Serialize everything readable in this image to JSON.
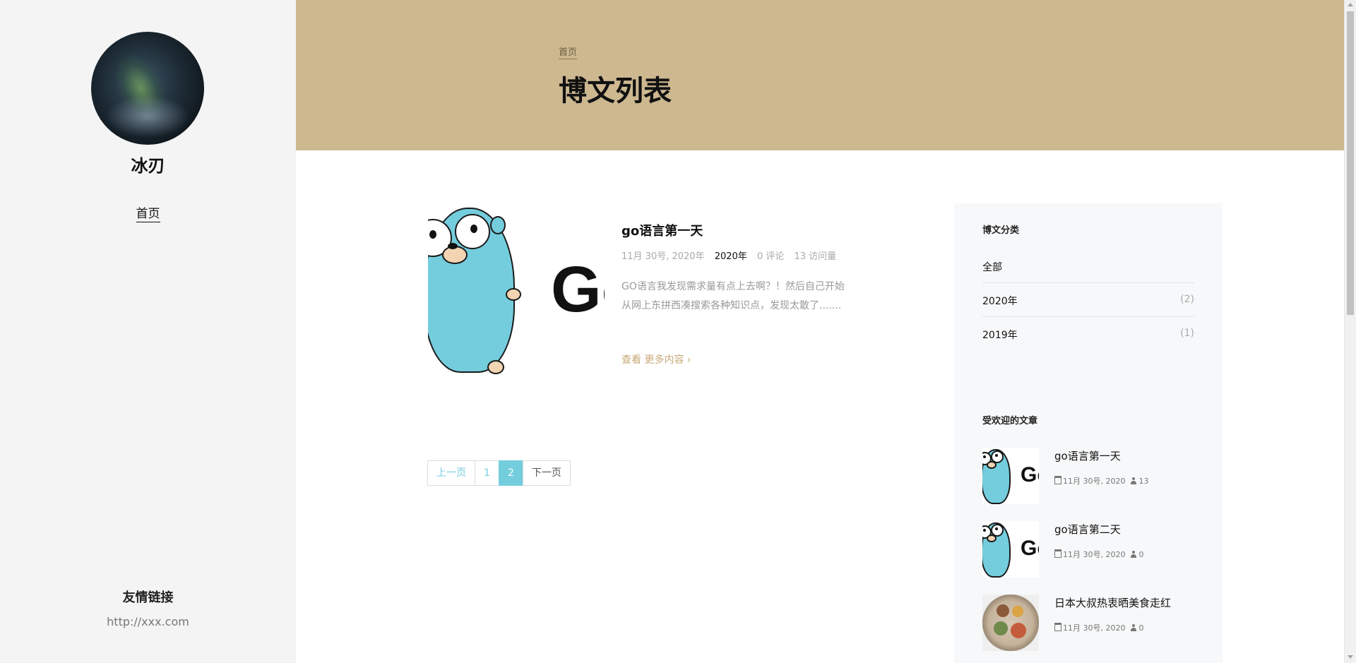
{
  "sidebar": {
    "author_name": "冰刃",
    "nav_home": "首页",
    "friend_links_title": "友情链接",
    "friend_link_url": "http://xxx.com"
  },
  "header": {
    "breadcrumb": "首页",
    "page_title": "博文列表",
    "bg_color": "#cdb890"
  },
  "post": {
    "title": "go语言第一天",
    "date": "11月 30号, 2020年",
    "year": "2020年",
    "comments": "0 评论",
    "views": "13 访问量",
    "excerpt": "GO语言我发现需求量有点上去啊？！然后自己开始从网上东拼西凑搜索各种知识点，发现太散了.......",
    "more": "查看 更多内容",
    "thumb_text": "Go"
  },
  "pagination": {
    "prev": "上一页",
    "pages": [
      "1",
      "2"
    ],
    "active": "2",
    "next": "下一页"
  },
  "categories": {
    "title": "博文分类",
    "items": [
      {
        "label": "全部",
        "count": ""
      },
      {
        "label": "2020年",
        "count": "(2)"
      },
      {
        "label": "2019年",
        "count": "(1)"
      }
    ]
  },
  "popular": {
    "title": "受欢迎的文章",
    "items": [
      {
        "title": "go语言第一天",
        "date": "11月 30号, 2020",
        "views": "13",
        "thumb": "gopher",
        "thumb_text": "Go"
      },
      {
        "title": "go语言第二天",
        "date": "11月 30号, 2020",
        "views": "0",
        "thumb": "gopher",
        "thumb_text": "Go"
      },
      {
        "title": "日本大叔热衷晒美食走红",
        "date": "11月 30号, 2020",
        "views": "0",
        "thumb": "food-photo"
      }
    ]
  },
  "colors": {
    "accent": "#74cddd",
    "link_gold": "#c8a877"
  }
}
